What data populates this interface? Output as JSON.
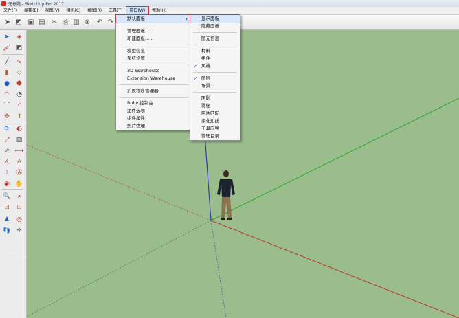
{
  "window": {
    "title": "无标题 - SketchUp Pro 2017"
  },
  "menubar": [
    "文件(F)",
    "编辑(E)",
    "视图(V)",
    "相机(C)",
    "绘图(R)",
    "工具(T)",
    "窗口(W)",
    "帮助(H)"
  ],
  "window_menu": {
    "items": [
      {
        "label": "默认面板",
        "submenu": true,
        "highlighted": true
      },
      {
        "sep": true
      },
      {
        "label": "管理面板......"
      },
      {
        "label": "新建面板......"
      },
      {
        "sep": true
      },
      {
        "label": "模型信息"
      },
      {
        "label": "系统设置"
      },
      {
        "sep": true
      },
      {
        "label": "3D Warehouse"
      },
      {
        "label": "Extension Warehouse"
      },
      {
        "sep": true
      },
      {
        "label": "扩展程序管理器"
      },
      {
        "sep": true
      },
      {
        "label": "Ruby 控制台"
      },
      {
        "label": "组件选项"
      },
      {
        "label": "组件属性"
      },
      {
        "label": "照片纹理"
      }
    ]
  },
  "default_panel_submenu": {
    "items": [
      {
        "label": "显示面板",
        "highlighted": true
      },
      {
        "label": "隐藏面板"
      },
      {
        "sep": true
      },
      {
        "label": "图元信息"
      },
      {
        "sep": true
      },
      {
        "label": "材料"
      },
      {
        "label": "组件"
      },
      {
        "label": "风格",
        "checked": true
      },
      {
        "sep": true
      },
      {
        "label": "图层",
        "checked": true
      },
      {
        "label": "场景"
      },
      {
        "sep": true
      },
      {
        "label": "阴影"
      },
      {
        "label": "雾化"
      },
      {
        "label": "照片匹配"
      },
      {
        "label": "柔化边线"
      },
      {
        "label": "工具向导"
      },
      {
        "label": "管理目录"
      }
    ]
  },
  "toolbar": {
    "icons": [
      "select-icon",
      "eraser-icon",
      "folder-icon",
      "save-icon",
      "cut-icon",
      "copy-icon",
      "paste-icon",
      "delete-icon",
      "undo-icon",
      "redo-icon"
    ]
  },
  "left_toolbar": {
    "icons": [
      "select-icon",
      "component-icon",
      "paint-icon",
      "eraser-icon",
      "line-icon",
      "freehand-icon",
      "rectangle-icon",
      "rotated-rect-icon",
      "circle-icon",
      "polygon-icon",
      "arc-icon",
      "pie-icon",
      "arc-2pt-icon",
      "arc-3pt-icon",
      "move-icon",
      "push-pull-icon",
      "rotate-icon",
      "follow-me-icon",
      "scale-icon",
      "offset-icon",
      "tape-icon",
      "dimension-icon",
      "protractor-icon",
      "text-icon",
      "axes-icon",
      "3d-text-icon",
      "orbit-icon",
      "pan-icon",
      "zoom-icon",
      "zoom-window-icon",
      "zoom-extents-icon",
      "previous-view-icon",
      "position-camera-icon",
      "look-around-icon",
      "walk-icon",
      "section-icon"
    ]
  },
  "colors": {
    "canvas": "#9bbc8c",
    "x_axis": "#c0392b",
    "y_axis": "#2ea52e",
    "z_axis": "#2b3fb0",
    "highlight": "#e03030"
  }
}
